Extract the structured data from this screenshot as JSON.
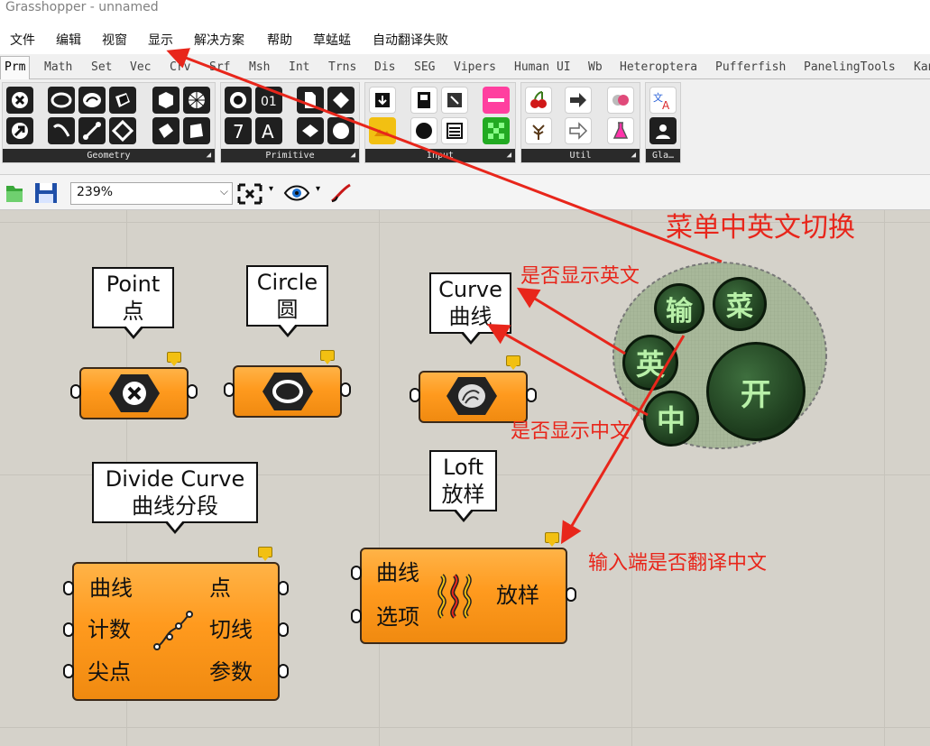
{
  "window": {
    "title": "Grasshopper - unnamed"
  },
  "menu": [
    "文件",
    "编辑",
    "视窗",
    "显示",
    "解决方案",
    "帮助",
    "草蜢蜢",
    "自动翻译失败"
  ],
  "tabs": [
    "Prm",
    "Math",
    "Set",
    "Vec",
    "Crv",
    "Srf",
    "Msh",
    "Int",
    "Trns",
    "Dis",
    "SEG",
    "Vipers",
    "Human UI",
    "Wb",
    "Heteroptera",
    "Pufferfish",
    "PanelingTools",
    "Kan"
  ],
  "ribbon_groups": [
    "Geometry",
    "Primitive",
    "Input",
    "Util",
    "Gla…"
  ],
  "toolbar": {
    "zoom": "239%"
  },
  "components": {
    "point": {
      "tip_en": "Point",
      "tip_zh": "点"
    },
    "circle": {
      "tip_en": "Circle",
      "tip_zh": "圆"
    },
    "curve": {
      "tip_en": "Curve",
      "tip_zh": "曲线"
    },
    "divide": {
      "tip_en": "Divide Curve",
      "tip_zh": "曲线分段",
      "inputs": [
        "曲线",
        "计数",
        "尖点"
      ],
      "outputs": [
        "点",
        "切线",
        "参数"
      ]
    },
    "loft": {
      "tip_en": "Loft",
      "tip_zh": "放样",
      "inputs": [
        "曲线",
        "选项"
      ],
      "outputs": [
        "放样"
      ]
    }
  },
  "annotations": {
    "menu_switch": "菜单中英文切换",
    "show_english": "是否显示英文",
    "show_chinese": "是否显示中文",
    "translate_inputs": "输入端是否翻译中文"
  },
  "widget": {
    "on": "开",
    "menu": "菜",
    "input": "输",
    "english": "英",
    "chinese": "中"
  },
  "colors": {
    "annotation": "#e8261b",
    "component": "#ff9a1e",
    "toggle": "#1c3a1c"
  }
}
